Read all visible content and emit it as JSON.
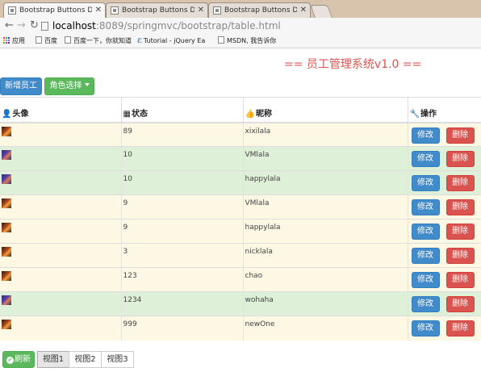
{
  "browser": {
    "tabs": [
      {
        "title": "Bootstrap Buttons Dem",
        "active": true
      },
      {
        "title": "Bootstrap Buttons Dem",
        "active": false
      },
      {
        "title": "Bootstrap Buttons Dem",
        "active": false
      }
    ],
    "url_host": "localhost",
    "url_rest": ":8089/springmvc/bootstrap/table.html",
    "bookmarks": [
      "应用",
      "百度",
      "百度一下，你就知道",
      "Tutorial - jQuery Ea",
      "MSDN, 我告诉你"
    ]
  },
  "header": {
    "title": "== 员工管理系统v1.0 ==",
    "title_color": "#d9534f"
  },
  "toolbar": {
    "add_label": "新增员工",
    "role_label": "角色选择"
  },
  "table": {
    "columns": [
      {
        "icon": "user-icon",
        "glyph": "👤",
        "label": "头像"
      },
      {
        "icon": "grid-icon",
        "glyph": "▦",
        "label": "状态"
      },
      {
        "icon": "thumbs-up-icon",
        "glyph": "👍",
        "label": "昵称"
      },
      {
        "icon": "wrench-icon",
        "glyph": "🔧",
        "label": "操作"
      }
    ],
    "edit_label": "修改",
    "delete_label": "删除",
    "rows": [
      {
        "style": "warning",
        "avatar": "a1",
        "status": "89",
        "nickname": "xixilala"
      },
      {
        "style": "success",
        "avatar": "a2",
        "status": "10",
        "nickname": "VMlala"
      },
      {
        "style": "success",
        "avatar": "a2",
        "status": "10",
        "nickname": "happylala"
      },
      {
        "style": "warning",
        "avatar": "a1",
        "status": "9",
        "nickname": "VMlala"
      },
      {
        "style": "warning",
        "avatar": "a1",
        "status": "9",
        "nickname": "happylala"
      },
      {
        "style": "warning",
        "avatar": "a1",
        "status": "3",
        "nickname": "nicklala"
      },
      {
        "style": "warning",
        "avatar": "a1",
        "status": "123",
        "nickname": "chao"
      },
      {
        "style": "success",
        "avatar": "a2",
        "status": "1234",
        "nickname": "wohaha"
      },
      {
        "style": "warning",
        "avatar": "a1",
        "status": "999",
        "nickname": "newOne"
      }
    ]
  },
  "footer": {
    "refresh_label": "刷新",
    "views": [
      "视图1",
      "视图2",
      "视图3"
    ]
  },
  "colors": {
    "primary": "#428bca",
    "success": "#5cb85c",
    "danger": "#d9534f",
    "row_warning": "#fcf8e3",
    "row_success": "#dff0d8"
  }
}
